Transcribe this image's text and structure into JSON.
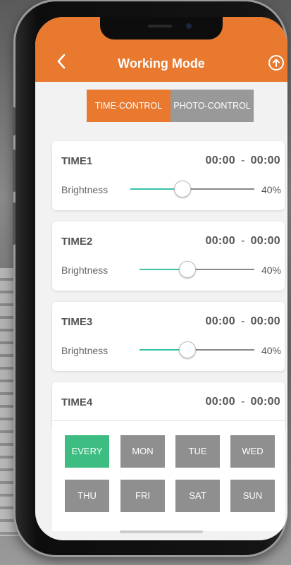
{
  "header": {
    "title": "Working Mode",
    "back_icon": "chevron-left-icon",
    "upload_icon": "upload-circle-icon",
    "color": "#e8792f"
  },
  "mode_tabs": [
    {
      "label": "TIME-CONTROL",
      "active": true
    },
    {
      "label": "PHOTO-CONTROL",
      "active": false
    }
  ],
  "time_slots": [
    {
      "name": "TIME1",
      "start": "00:00",
      "sep": "-",
      "end": "00:00",
      "brightness_label": "Brightness",
      "brightness": "40%",
      "level": 0.4
    },
    {
      "name": "TIME2",
      "start": "00:00",
      "sep": "-",
      "end": "00:00",
      "brightness_label": "Brightness",
      "brightness": "40%",
      "level": 0.4
    },
    {
      "name": "TIME3",
      "start": "00:00",
      "sep": "-",
      "end": "00:00",
      "brightness_label": "Brightness",
      "brightness": "40%",
      "level": 0.4
    },
    {
      "name": "TIME4",
      "start": "00:00",
      "sep": "-",
      "end": "00:00"
    }
  ],
  "days": [
    {
      "label": "EVERY",
      "active": true
    },
    {
      "label": "MON",
      "active": false
    },
    {
      "label": "TUE",
      "active": false
    },
    {
      "label": "WED",
      "active": false
    },
    {
      "label": "THU",
      "active": false
    },
    {
      "label": "FRI",
      "active": false
    },
    {
      "label": "SAT",
      "active": false
    },
    {
      "label": "SUN",
      "active": false
    }
  ],
  "colors": {
    "accent": "#e8792f",
    "active_day": "#3ebd82",
    "slider_fill": "#37c2a6",
    "inactive": "#999999"
  }
}
